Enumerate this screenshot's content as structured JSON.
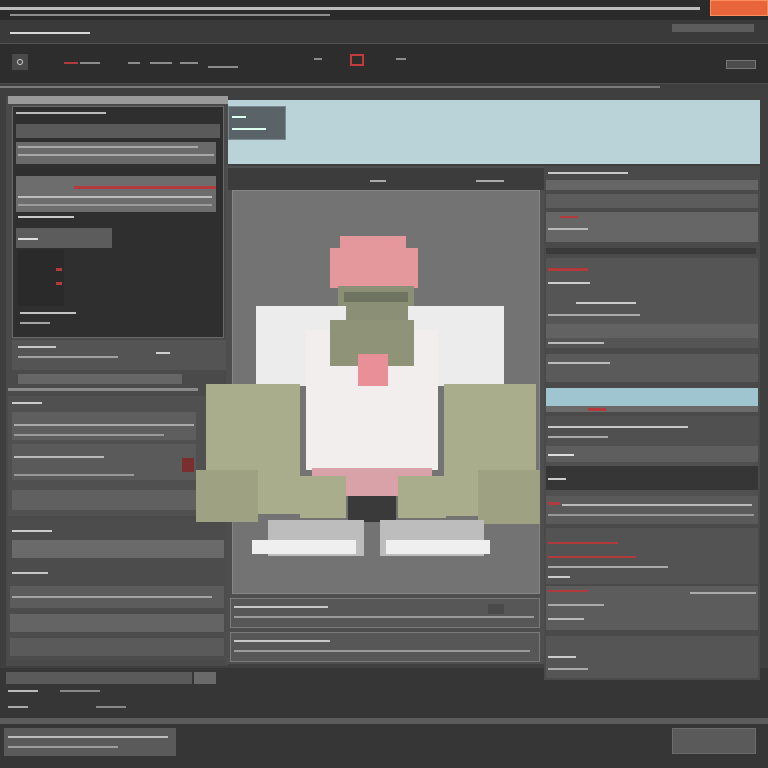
{
  "app": {
    "title": "",
    "top_button": "",
    "accent": "#e8643a"
  },
  "menu": {
    "title_bits": "",
    "tool_labels": [
      "",
      "",
      ""
    ]
  },
  "left": {
    "section_titles": [
      "",
      "",
      ""
    ],
    "values": [
      "",
      "",
      ""
    ],
    "status": ""
  },
  "right": {
    "section_titles": [
      "",
      "",
      ""
    ],
    "values": [
      "",
      "",
      ""
    ],
    "status": ""
  },
  "canvas": {
    "label": "",
    "footer_labels": [
      "",
      ""
    ]
  },
  "colors": {
    "sky": "#b9d3d8",
    "panel": "#585858",
    "dark": "#2f2f2f",
    "red": "#e04848"
  },
  "icons": [
    "close-icon",
    "gear-icon",
    "layers-icon",
    "brush-icon"
  ]
}
